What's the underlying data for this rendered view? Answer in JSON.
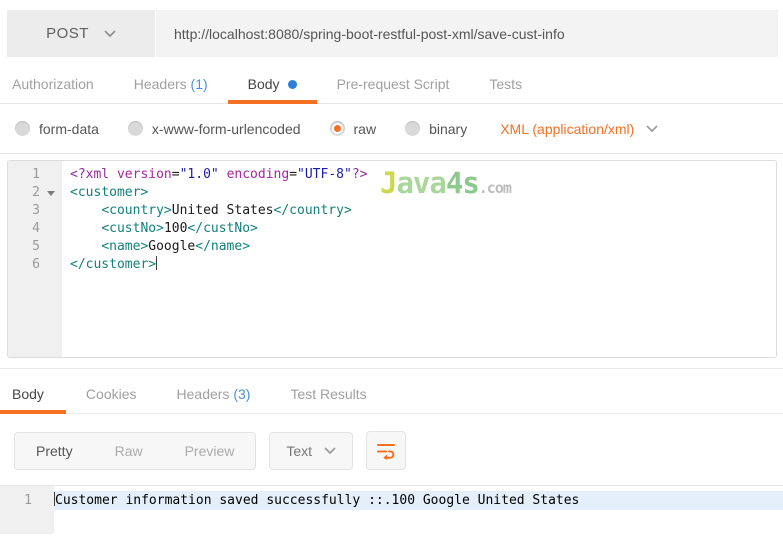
{
  "colors": {
    "accent_orange": "#f47023",
    "link_blue": "#4a90d9",
    "dot_blue": "#2d7fd9",
    "tag_teal": "#12807d",
    "attr_purple": "#a626a4",
    "string_navy": "#1b1bab"
  },
  "request_bar": {
    "method": "POST",
    "url": "http://localhost:8080/spring-boot-restful-post-xml/save-cust-info"
  },
  "request_tabs": [
    {
      "label": "Authorization"
    },
    {
      "label": "Headers",
      "count": "(1)"
    },
    {
      "label": "Body",
      "dot": true,
      "active": true
    },
    {
      "label": "Pre-request Script"
    },
    {
      "label": "Tests"
    }
  ],
  "body_type": {
    "options": [
      {
        "label": "form-data"
      },
      {
        "label": "x-www-form-urlencoded"
      },
      {
        "label": "raw",
        "selected": true
      },
      {
        "label": "binary"
      }
    ],
    "content_type": "XML (application/xml)"
  },
  "watermark": {
    "segments": [
      {
        "text": "J",
        "color": "#ccd94e"
      },
      {
        "text": "ava",
        "color": "#a9d69b"
      },
      {
        "text": "4s",
        "color": "#8cc98c"
      }
    ],
    "suffix": ".com",
    "suffix_color": "#bdbdbd"
  },
  "request_editor": {
    "lines": [
      {
        "num": "1",
        "tokens": [
          [
            "meta",
            "<?xml "
          ],
          [
            "attr",
            "version"
          ],
          [
            "plain",
            "="
          ],
          [
            "str",
            "\"1.0\""
          ],
          [
            "plain",
            " "
          ],
          [
            "attr",
            "encoding"
          ],
          [
            "plain",
            "="
          ],
          [
            "str",
            "\"UTF-8\""
          ],
          [
            "meta",
            "?>"
          ]
        ]
      },
      {
        "num": "2",
        "fold": true,
        "tokens": [
          [
            "tag",
            "<customer>"
          ]
        ]
      },
      {
        "num": "3",
        "tokens": [
          [
            "plain",
            "    "
          ],
          [
            "tag",
            "<country>"
          ],
          [
            "plain",
            "United States"
          ],
          [
            "tag",
            "</country>"
          ]
        ]
      },
      {
        "num": "4",
        "tokens": [
          [
            "plain",
            "    "
          ],
          [
            "tag",
            "<custNo>"
          ],
          [
            "plain",
            "100"
          ],
          [
            "tag",
            "</custNo>"
          ]
        ]
      },
      {
        "num": "5",
        "tokens": [
          [
            "plain",
            "    "
          ],
          [
            "tag",
            "<name>"
          ],
          [
            "plain",
            "Google"
          ],
          [
            "tag",
            "</name>"
          ]
        ]
      },
      {
        "num": "6",
        "cursor": true,
        "tokens": [
          [
            "tag",
            "</customer>"
          ]
        ]
      }
    ]
  },
  "response_tabs": [
    {
      "label": "Body",
      "active": true
    },
    {
      "label": "Cookies"
    },
    {
      "label": "Headers",
      "count": "(3)"
    },
    {
      "label": "Test Results"
    }
  ],
  "response_toolbar": {
    "views": [
      {
        "label": "Pretty",
        "active": true
      },
      {
        "label": "Raw"
      },
      {
        "label": "Preview"
      }
    ],
    "format": "Text"
  },
  "response_body": {
    "lines": [
      {
        "num": "1",
        "text": "Customer information saved successfully ::.100 Google United States",
        "highlighted": true,
        "cursor": true
      }
    ]
  }
}
